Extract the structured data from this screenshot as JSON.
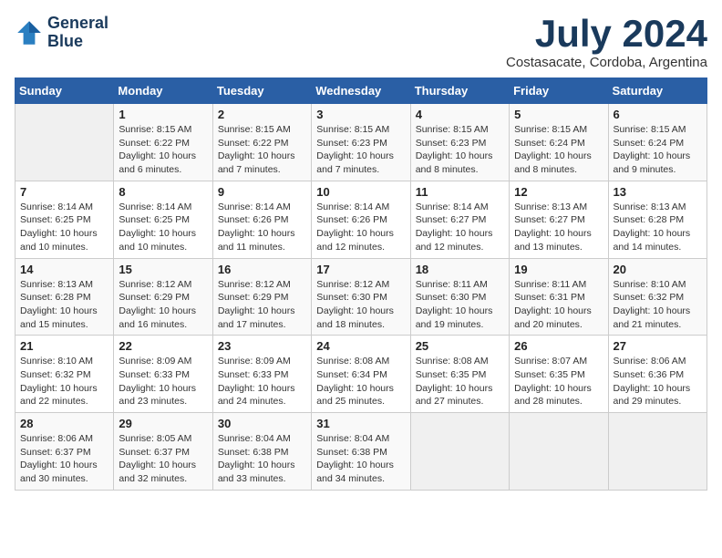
{
  "logo": {
    "line1": "General",
    "line2": "Blue"
  },
  "title": "July 2024",
  "location": "Costasacate, Cordoba, Argentina",
  "days_of_week": [
    "Sunday",
    "Monday",
    "Tuesday",
    "Wednesday",
    "Thursday",
    "Friday",
    "Saturday"
  ],
  "weeks": [
    [
      {
        "day": "",
        "info": ""
      },
      {
        "day": "1",
        "info": "Sunrise: 8:15 AM\nSunset: 6:22 PM\nDaylight: 10 hours\nand 6 minutes."
      },
      {
        "day": "2",
        "info": "Sunrise: 8:15 AM\nSunset: 6:22 PM\nDaylight: 10 hours\nand 7 minutes."
      },
      {
        "day": "3",
        "info": "Sunrise: 8:15 AM\nSunset: 6:23 PM\nDaylight: 10 hours\nand 7 minutes."
      },
      {
        "day": "4",
        "info": "Sunrise: 8:15 AM\nSunset: 6:23 PM\nDaylight: 10 hours\nand 8 minutes."
      },
      {
        "day": "5",
        "info": "Sunrise: 8:15 AM\nSunset: 6:24 PM\nDaylight: 10 hours\nand 8 minutes."
      },
      {
        "day": "6",
        "info": "Sunrise: 8:15 AM\nSunset: 6:24 PM\nDaylight: 10 hours\nand 9 minutes."
      }
    ],
    [
      {
        "day": "7",
        "info": "Sunrise: 8:14 AM\nSunset: 6:25 PM\nDaylight: 10 hours\nand 10 minutes."
      },
      {
        "day": "8",
        "info": "Sunrise: 8:14 AM\nSunset: 6:25 PM\nDaylight: 10 hours\nand 10 minutes."
      },
      {
        "day": "9",
        "info": "Sunrise: 8:14 AM\nSunset: 6:26 PM\nDaylight: 10 hours\nand 11 minutes."
      },
      {
        "day": "10",
        "info": "Sunrise: 8:14 AM\nSunset: 6:26 PM\nDaylight: 10 hours\nand 12 minutes."
      },
      {
        "day": "11",
        "info": "Sunrise: 8:14 AM\nSunset: 6:27 PM\nDaylight: 10 hours\nand 12 minutes."
      },
      {
        "day": "12",
        "info": "Sunrise: 8:13 AM\nSunset: 6:27 PM\nDaylight: 10 hours\nand 13 minutes."
      },
      {
        "day": "13",
        "info": "Sunrise: 8:13 AM\nSunset: 6:28 PM\nDaylight: 10 hours\nand 14 minutes."
      }
    ],
    [
      {
        "day": "14",
        "info": "Sunrise: 8:13 AM\nSunset: 6:28 PM\nDaylight: 10 hours\nand 15 minutes."
      },
      {
        "day": "15",
        "info": "Sunrise: 8:12 AM\nSunset: 6:29 PM\nDaylight: 10 hours\nand 16 minutes."
      },
      {
        "day": "16",
        "info": "Sunrise: 8:12 AM\nSunset: 6:29 PM\nDaylight: 10 hours\nand 17 minutes."
      },
      {
        "day": "17",
        "info": "Sunrise: 8:12 AM\nSunset: 6:30 PM\nDaylight: 10 hours\nand 18 minutes."
      },
      {
        "day": "18",
        "info": "Sunrise: 8:11 AM\nSunset: 6:30 PM\nDaylight: 10 hours\nand 19 minutes."
      },
      {
        "day": "19",
        "info": "Sunrise: 8:11 AM\nSunset: 6:31 PM\nDaylight: 10 hours\nand 20 minutes."
      },
      {
        "day": "20",
        "info": "Sunrise: 8:10 AM\nSunset: 6:32 PM\nDaylight: 10 hours\nand 21 minutes."
      }
    ],
    [
      {
        "day": "21",
        "info": "Sunrise: 8:10 AM\nSunset: 6:32 PM\nDaylight: 10 hours\nand 22 minutes."
      },
      {
        "day": "22",
        "info": "Sunrise: 8:09 AM\nSunset: 6:33 PM\nDaylight: 10 hours\nand 23 minutes."
      },
      {
        "day": "23",
        "info": "Sunrise: 8:09 AM\nSunset: 6:33 PM\nDaylight: 10 hours\nand 24 minutes."
      },
      {
        "day": "24",
        "info": "Sunrise: 8:08 AM\nSunset: 6:34 PM\nDaylight: 10 hours\nand 25 minutes."
      },
      {
        "day": "25",
        "info": "Sunrise: 8:08 AM\nSunset: 6:35 PM\nDaylight: 10 hours\nand 27 minutes."
      },
      {
        "day": "26",
        "info": "Sunrise: 8:07 AM\nSunset: 6:35 PM\nDaylight: 10 hours\nand 28 minutes."
      },
      {
        "day": "27",
        "info": "Sunrise: 8:06 AM\nSunset: 6:36 PM\nDaylight: 10 hours\nand 29 minutes."
      }
    ],
    [
      {
        "day": "28",
        "info": "Sunrise: 8:06 AM\nSunset: 6:37 PM\nDaylight: 10 hours\nand 30 minutes."
      },
      {
        "day": "29",
        "info": "Sunrise: 8:05 AM\nSunset: 6:37 PM\nDaylight: 10 hours\nand 32 minutes."
      },
      {
        "day": "30",
        "info": "Sunrise: 8:04 AM\nSunset: 6:38 PM\nDaylight: 10 hours\nand 33 minutes."
      },
      {
        "day": "31",
        "info": "Sunrise: 8:04 AM\nSunset: 6:38 PM\nDaylight: 10 hours\nand 34 minutes."
      },
      {
        "day": "",
        "info": ""
      },
      {
        "day": "",
        "info": ""
      },
      {
        "day": "",
        "info": ""
      }
    ]
  ]
}
